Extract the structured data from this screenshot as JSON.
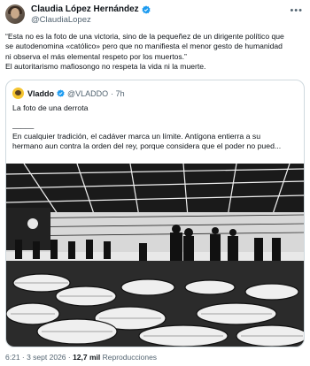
{
  "author": {
    "display_name": "Claudia López Hernández",
    "handle": "@ClaudiaLopez"
  },
  "tweet": {
    "line1": "“Esta no es la foto de una victoria, sino de la pequeñez de un dirigente político que",
    "line2": "se autodenomina «católico» pero que no manifiesta el menor gesto de humanidad",
    "line3": "ni observa el más elemental respeto por los muertos.”",
    "line4": "El autoritarismo mafiosongo no respeta la vida ni la muerte."
  },
  "quote": {
    "display_name": "Vladdo",
    "handle": "@VLADDO",
    "time": "· 7h",
    "title": "La foto de una derrota",
    "divider": "_____",
    "line1": "En cualquier tradición, el cadáver marca un límite. Antígona entierra a su",
    "line2": "hermano aun contra la orden del rey, porque considera que el poder no pued..."
  },
  "footer": {
    "time": "6:21 · 3 sept 2026 · ",
    "views": "12,7 mil",
    "views_label": " Reproducciones"
  },
  "colors": {
    "verified": "#1d9bf0",
    "muted": "#536471",
    "border": "#cfd9de"
  }
}
